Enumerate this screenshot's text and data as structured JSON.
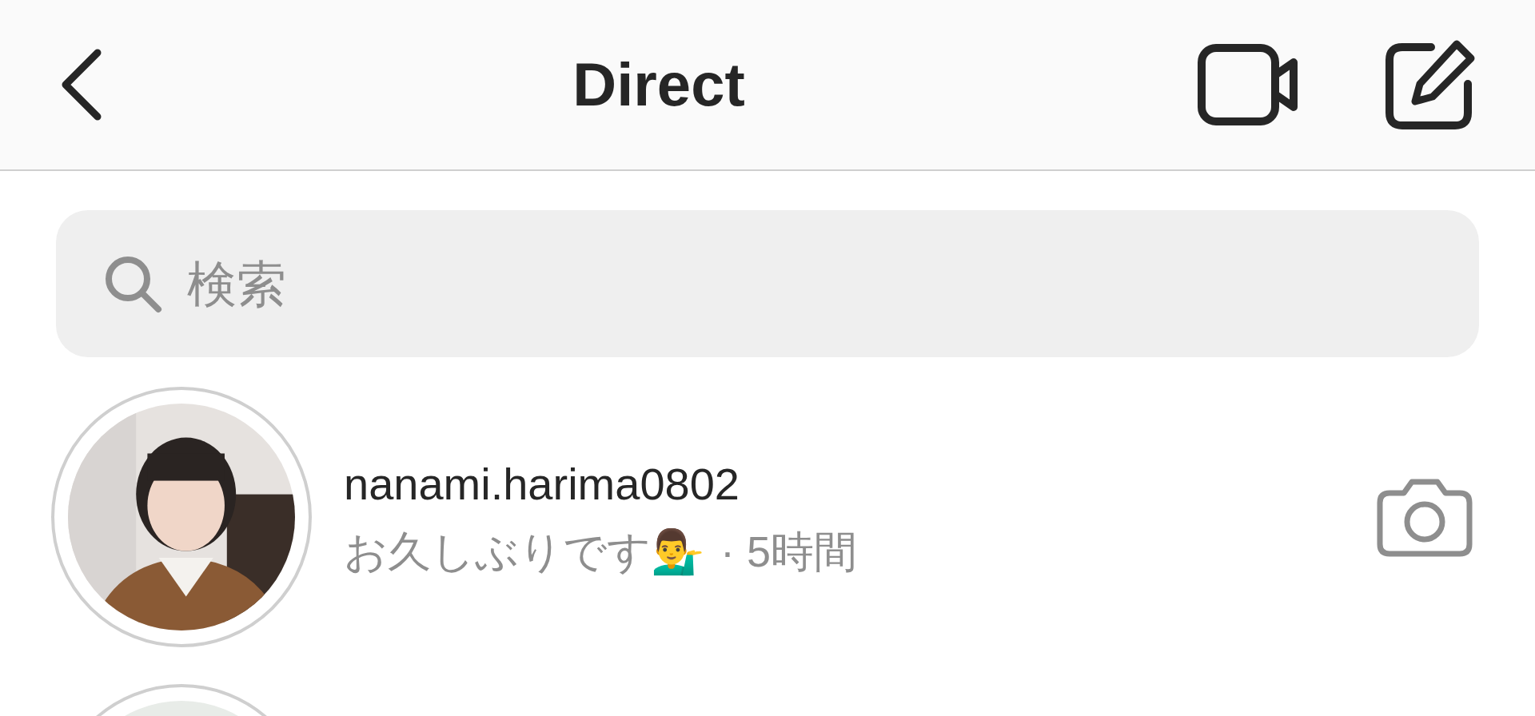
{
  "header": {
    "title": "Direct"
  },
  "search": {
    "placeholder": "検索"
  },
  "conversations": [
    {
      "kind": "thread",
      "username": "nanami.harima0802",
      "message": "お久しぶりです💁‍♂️",
      "time": "· 5時間"
    },
    {
      "kind": "avatar_only"
    }
  ]
}
